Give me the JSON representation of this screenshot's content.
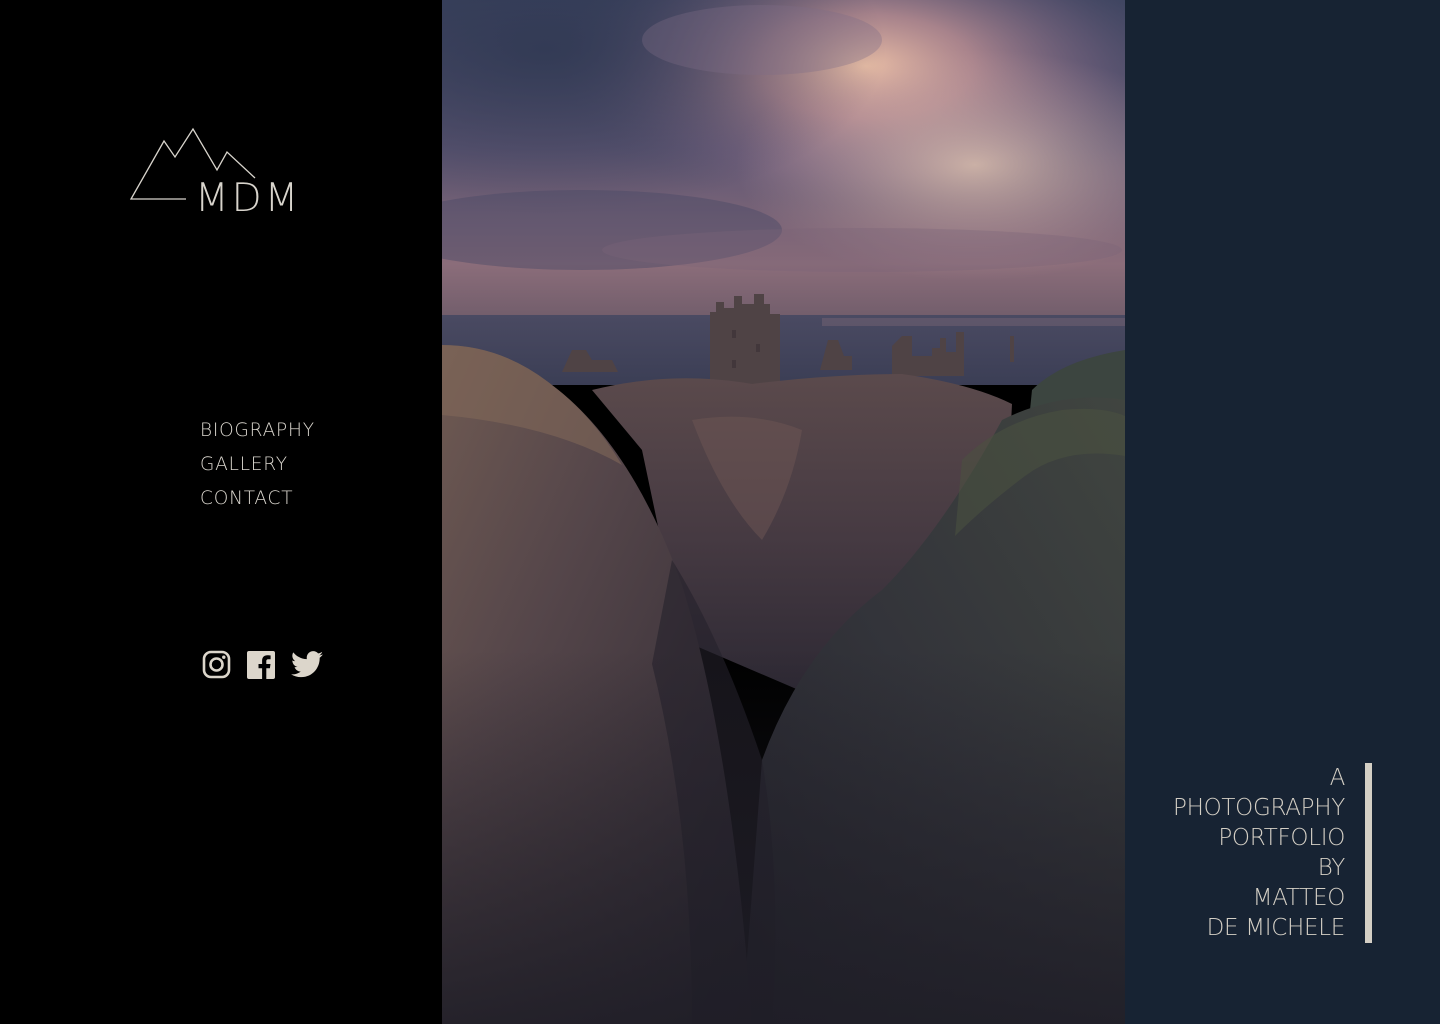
{
  "brand": {
    "logo_text": "MDM"
  },
  "nav": {
    "items": [
      {
        "label": "BIOGRAPHY"
      },
      {
        "label": "GALLERY"
      },
      {
        "label": "CONTACT"
      }
    ]
  },
  "social": {
    "icons": [
      "instagram-icon",
      "facebook-icon",
      "twitter-icon"
    ]
  },
  "hero": {
    "image": "castle-ruins-on-cliffs-at-dusk"
  },
  "tagline": {
    "lines": [
      "A",
      "PHOTOGRAPHY",
      "PORTFOLIO",
      "BY",
      "MATTEO",
      "DE MICHELE"
    ]
  },
  "colors": {
    "sidebar_bg": "#000000",
    "panel_bg": "#172333",
    "text": "#d8d4cc"
  }
}
